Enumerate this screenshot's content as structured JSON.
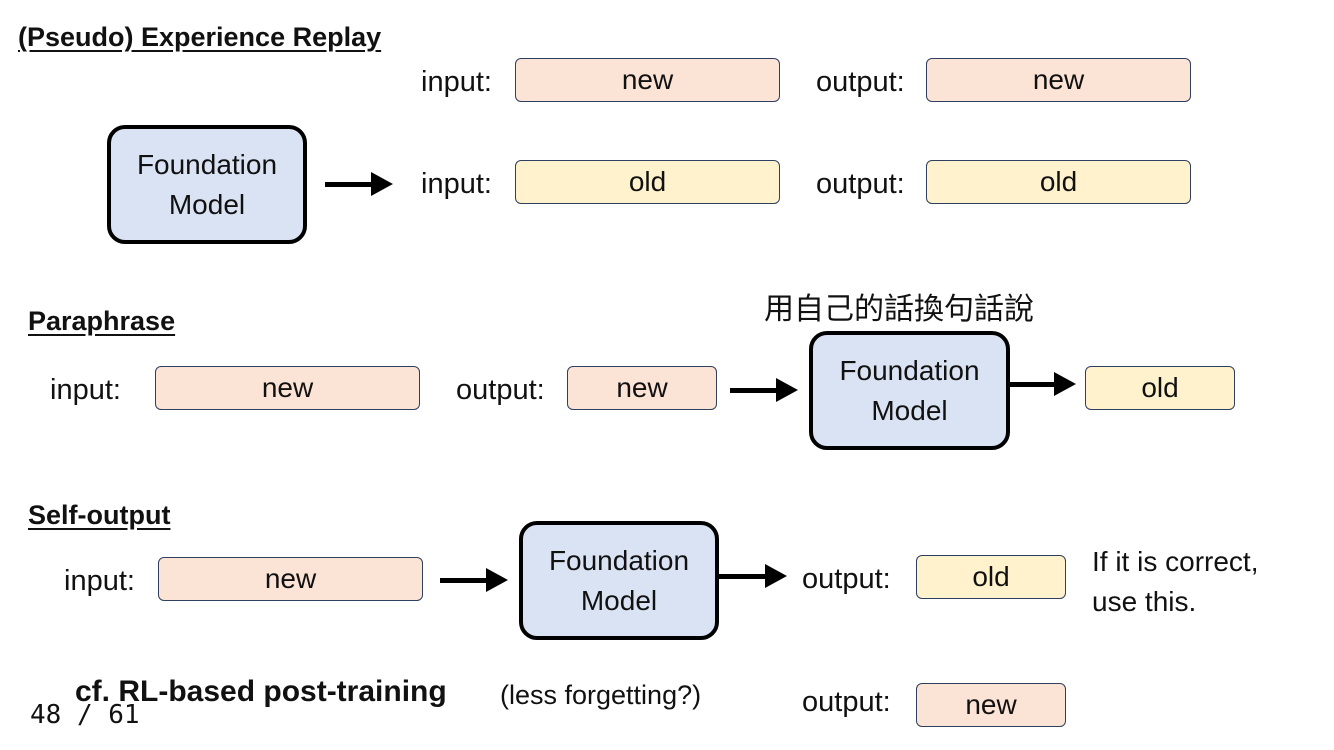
{
  "sections": {
    "experience_replay": {
      "title": "(Pseudo) Experience Replay",
      "model": "Foundation\nModel",
      "row1": {
        "input_label": "input:",
        "input_value": "new",
        "output_label": "output:",
        "output_value": "new"
      },
      "row2": {
        "input_label": "input:",
        "input_value": "old",
        "output_label": "output:",
        "output_value": "old"
      }
    },
    "paraphrase": {
      "title": "Paraphrase",
      "annotation": "用自己的話換句話說",
      "input_label": "input:",
      "input_value": "new",
      "output_label": "output:",
      "output_value": "new",
      "model": "Foundation\nModel",
      "result_value": "old"
    },
    "self_output": {
      "title": "Self-output",
      "input_label": "input:",
      "input_value": "new",
      "model": "Foundation\nModel",
      "output_label": "output:",
      "output_value": "old",
      "note": "If it is correct,\nuse this."
    },
    "rl": {
      "title": "cf. RL-based post-training",
      "subtitle": "(less forgetting?)",
      "output_label": "output:",
      "output_value": "new"
    }
  },
  "footer": {
    "page_indicator": "48 / 61"
  },
  "colors": {
    "new_fill": "#fbe3d6",
    "old_fill": "#fff2cc",
    "model_fill": "#dae3f3",
    "border": "#2f3f5f"
  }
}
